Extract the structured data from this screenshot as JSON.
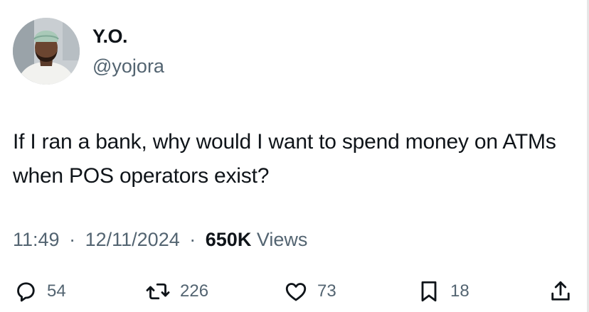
{
  "author": {
    "display_name": "Y.O.",
    "handle": "@yojora"
  },
  "tweet": {
    "text": "If I ran a bank, why would I want to spend money on ATMs when POS operators exist?"
  },
  "meta": {
    "time": "11:49",
    "separator": "·",
    "date": "12/11/2024",
    "views_count": "650K",
    "views_label": "Views"
  },
  "actions": {
    "replies": "54",
    "retweets": "226",
    "likes": "73",
    "bookmarks": "18"
  },
  "icons": [
    "reply-icon",
    "retweet-icon",
    "like-icon",
    "bookmark-icon",
    "share-icon"
  ],
  "colors": {
    "text_primary": "#0f1419",
    "text_secondary": "#536471"
  }
}
